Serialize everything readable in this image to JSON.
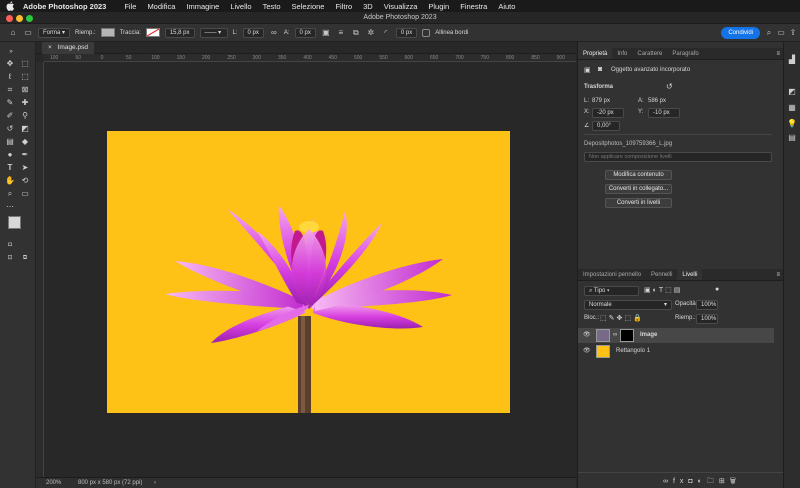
{
  "menubar": {
    "app_name": "Adobe Photoshop 2023",
    "items": [
      "File",
      "Modifica",
      "Immagine",
      "Livello",
      "Testo",
      "Selezione",
      "Filtro",
      "3D",
      "Visualizza",
      "Plugin",
      "Finestra",
      "Aiuto"
    ]
  },
  "window": {
    "title": "Adobe Photoshop 2023"
  },
  "options": {
    "mode": "Forma",
    "fill_label": "Riemp.:",
    "stroke_label": "Traccia:",
    "stroke_width": "15,8 px",
    "w_label": "L:",
    "w_value": "0 px",
    "h_label": "A:",
    "h_value": "0 px",
    "radius_value": "0 px",
    "align_edges": "Allinea bordi",
    "share": "Condividi"
  },
  "document": {
    "tab_name": "Image.psd",
    "zoom": "200%",
    "info": "800 px x 580 px (72 ppi)",
    "ruler_ticks": [
      "100",
      "50",
      "0",
      "50",
      "100",
      "150",
      "200",
      "250",
      "300",
      "350",
      "400",
      "450",
      "500",
      "550",
      "600",
      "650",
      "700",
      "750",
      "800",
      "850",
      "900"
    ]
  },
  "properties": {
    "tabs": [
      "Proprietà",
      "Info",
      "Carattere",
      "Paragrafo"
    ],
    "object_type": "Oggetto avanzato incorporato",
    "transform_label": "Trasforma",
    "l_label": "L:",
    "l_value": "879 px",
    "a_label": "A:",
    "a_value": "586 px",
    "x_label": "X:",
    "x_value": "-20 px",
    "y_label": "Y:",
    "y_value": "-10 px",
    "angle_value": "0,00°",
    "filename": "Depositphotos_109759366_L.jpg",
    "comp_placeholder": "Non applicare composizione livelli",
    "buttons": [
      "Modifica contenuto",
      "Converti in collegato...",
      "Converti in livelli"
    ]
  },
  "layers_panel": {
    "tabs": [
      "Impostazioni pennello",
      "Pennelli",
      "Livelli"
    ],
    "filter_kind": "Tipo",
    "blend_mode": "Normale",
    "opacity_label": "Opacità:",
    "opacity": "100%",
    "lock_label": "Bloc.:",
    "fill_label": "Riemp.:",
    "fill": "100%",
    "layers": [
      {
        "name": "Image",
        "selected": true
      },
      {
        "name": "Rettangolo 1",
        "selected": false
      }
    ]
  },
  "colors": {
    "artboard": "#fdc215",
    "petal": "#d63ee0",
    "accent_blue": "#1473e6"
  }
}
